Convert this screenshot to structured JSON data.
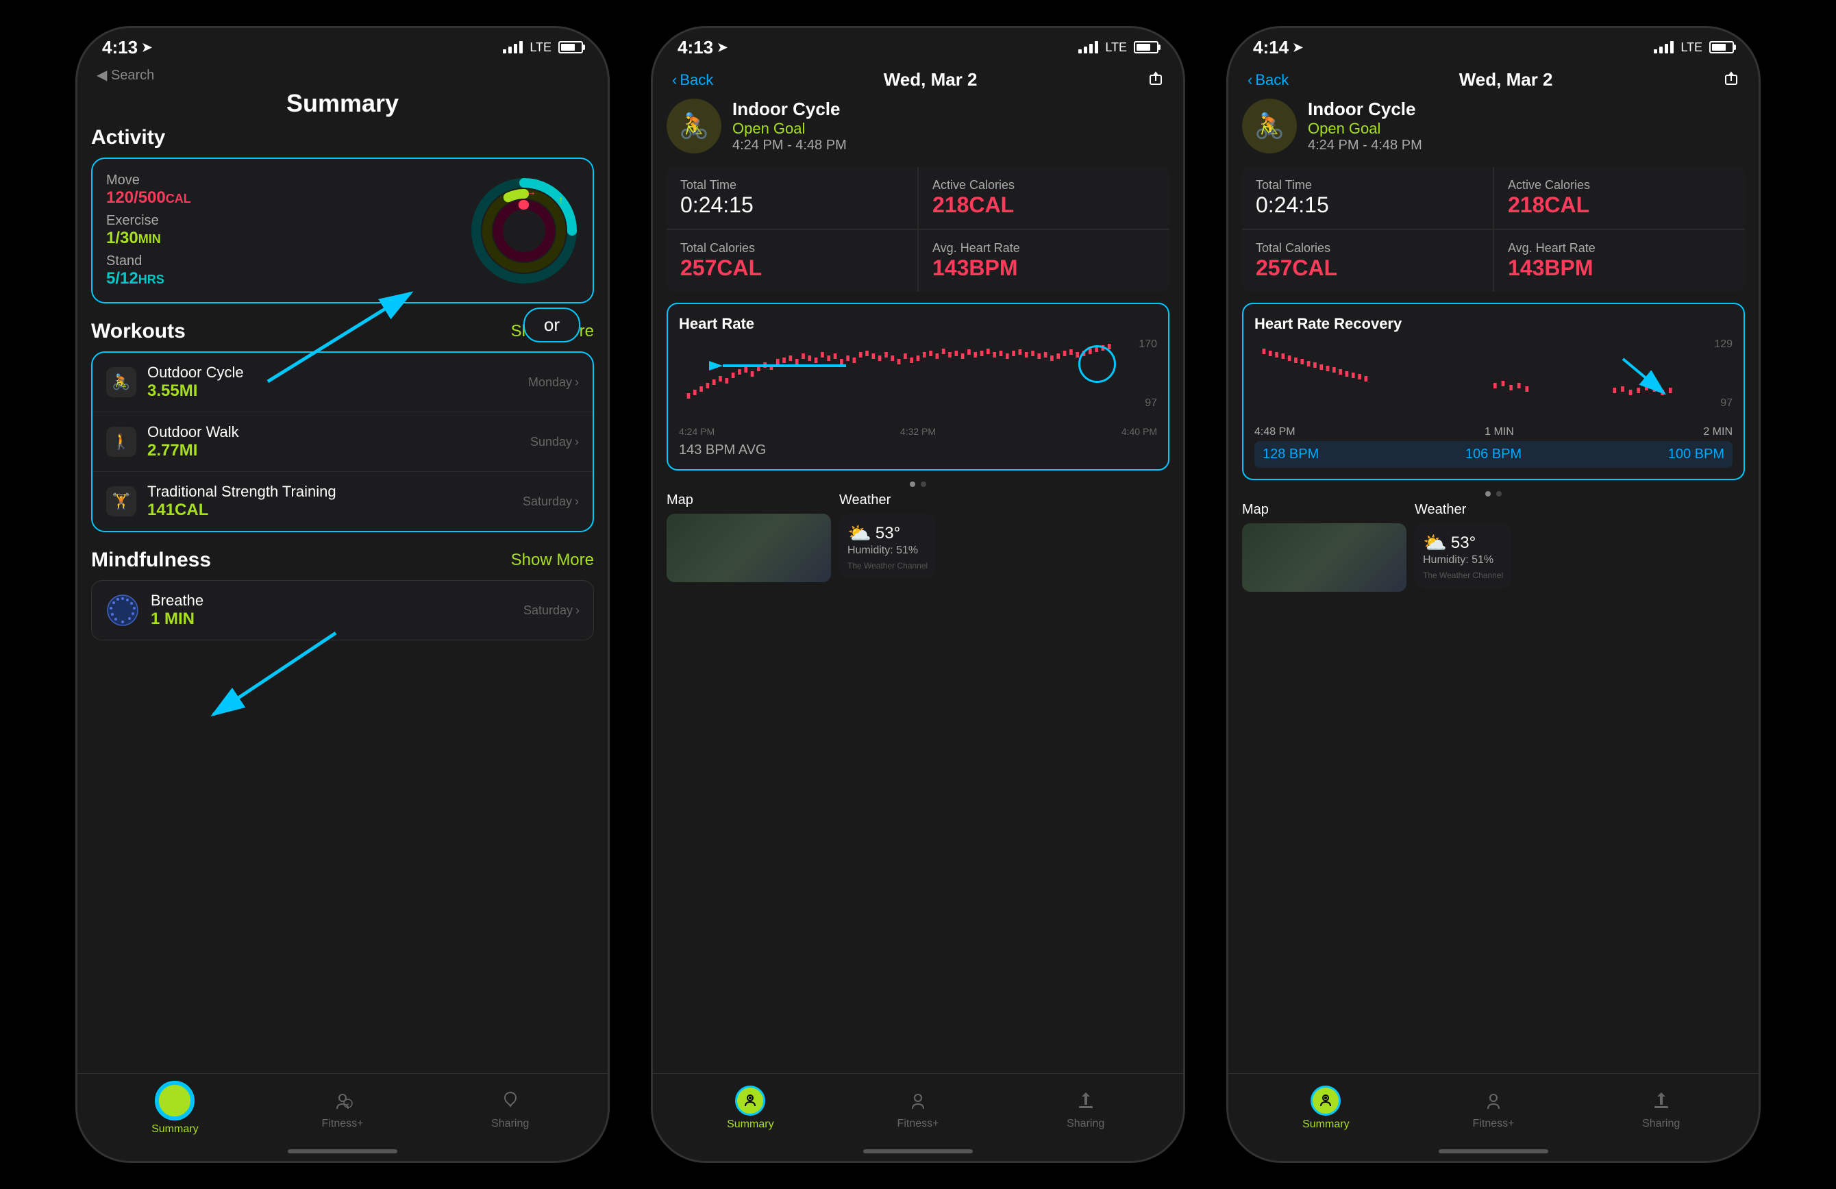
{
  "phones": [
    {
      "id": "summary",
      "statusBar": {
        "time": "4:13",
        "signal": "LTE",
        "battery": 70
      },
      "navTitle": "Summary",
      "search": "◀ Search",
      "sections": {
        "activity": {
          "title": "Activity",
          "move": {
            "label": "Move",
            "value": "120/500",
            "unit": "CAL"
          },
          "exercise": {
            "label": "Exercise",
            "value": "1/30",
            "unit": "MIN"
          },
          "stand": {
            "label": "Stand",
            "value": "5/12",
            "unit": "HRS"
          }
        },
        "workouts": {
          "title": "Workouts",
          "showMore": "Show More",
          "orButton": "or",
          "items": [
            {
              "icon": "🚴",
              "name": "Outdoor Cycle",
              "value": "3.55MI",
              "day": "Monday"
            },
            {
              "icon": "🚶",
              "name": "Outdoor Walk",
              "value": "2.77MI",
              "day": "Sunday"
            },
            {
              "icon": "🏋️",
              "name": "Traditional Strength Training",
              "value": "141CAL",
              "day": "Saturday"
            }
          ]
        },
        "mindfulness": {
          "title": "Mindfulness",
          "showMore": "Show More",
          "items": [
            {
              "name": "Breathe",
              "value": "1 MIN",
              "day": "Saturday"
            }
          ]
        }
      },
      "tabBar": {
        "items": [
          {
            "label": "Summary",
            "active": true
          },
          {
            "label": "Fitness+",
            "active": false
          },
          {
            "label": "Sharing",
            "active": false
          }
        ]
      }
    },
    {
      "id": "workout-detail-1",
      "statusBar": {
        "time": "4:13",
        "signal": "LTE"
      },
      "nav": {
        "back": "Back",
        "title": "Wed, Mar 2",
        "shareIcon": true
      },
      "workout": {
        "icon": "🚴",
        "type": "Indoor Cycle",
        "goal": "Open Goal",
        "timeRange": "4:24 PM - 4:48 PM"
      },
      "stats": [
        {
          "label": "Total Time",
          "value": "0:24:15",
          "type": "time"
        },
        {
          "label": "Active Calories",
          "value": "218CAL",
          "type": "red"
        },
        {
          "label": "Total Calories",
          "value": "257CAL",
          "type": "red"
        },
        {
          "label": "Avg. Heart Rate",
          "value": "143BPM",
          "type": "red"
        }
      ],
      "heartRate": {
        "title": "Heart Rate",
        "topValue": "170",
        "bottomValue": "97",
        "avgLabel": "143 BPM AVG",
        "xLabels": [
          "4:24 PM",
          "4:32 PM",
          "4:40 PM"
        ]
      },
      "weather": {
        "label": "Weather",
        "icon": "⛅",
        "temp": "53°",
        "humidity": "Humidity: 51%",
        "source": "The Weather Channel"
      },
      "map": {
        "label": "Map"
      },
      "tabBar": {
        "items": [
          {
            "label": "Summary",
            "active": true
          },
          {
            "label": "Fitness+",
            "active": false
          },
          {
            "label": "Sharing",
            "active": false
          }
        ]
      }
    },
    {
      "id": "workout-detail-2",
      "statusBar": {
        "time": "4:14",
        "signal": "LTE"
      },
      "nav": {
        "back": "Back",
        "title": "Wed, Mar 2",
        "shareIcon": true
      },
      "workout": {
        "icon": "🚴",
        "type": "Indoor Cycle",
        "goal": "Open Goal",
        "timeRange": "4:24 PM - 4:48 PM"
      },
      "stats": [
        {
          "label": "Total Time",
          "value": "0:24:15",
          "type": "time"
        },
        {
          "label": "Active Calories",
          "value": "218CAL",
          "type": "red"
        },
        {
          "label": "Total Calories",
          "value": "257CAL",
          "type": "red"
        },
        {
          "label": "Avg. Heart Rate",
          "value": "143BPM",
          "type": "red"
        }
      ],
      "heartRate": {
        "title": "Heart Rate Recovery",
        "topValue": "129",
        "bottomValue": "97",
        "labels": [
          "4:48 PM",
          "1 MIN",
          "2 MIN"
        ],
        "values": [
          "128 BPM",
          "106 BPM",
          "100 BPM"
        ]
      },
      "weather": {
        "label": "Weather",
        "icon": "⛅",
        "temp": "53°",
        "humidity": "Humidity: 51%",
        "source": "The Weather Channel"
      },
      "map": {
        "label": "Map"
      },
      "tabBar": {
        "items": [
          {
            "label": "Summary",
            "active": true
          },
          {
            "label": "Fitness+",
            "active": false
          },
          {
            "label": "Sharing",
            "active": false
          }
        ]
      }
    }
  ]
}
